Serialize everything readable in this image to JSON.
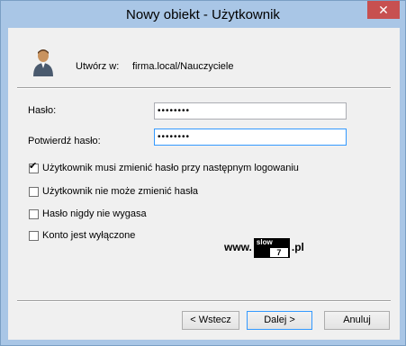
{
  "window": {
    "title": "Nowy obiekt - Użytkownik",
    "close_label": "✕"
  },
  "header": {
    "create_label": "Utwórz w:",
    "create_path": "firma.local/Nauczyciele"
  },
  "form": {
    "password_label": "Hasło:",
    "password_value": "••••••••",
    "confirm_label": "Potwierdź hasło:",
    "confirm_value": "••••••••"
  },
  "options": [
    {
      "label": "Użytkownik musi zmienić hasło przy następnym logowaniu",
      "checked": true
    },
    {
      "label": "Użytkownik nie może zmienić hasła",
      "checked": false
    },
    {
      "label": "Hasło nigdy nie wygasa",
      "checked": false
    },
    {
      "label": "Konto jest wyłączone",
      "checked": false
    }
  ],
  "watermark": {
    "prefix": "www.",
    "box_top": "slow",
    "box_num": "7",
    "suffix": ".pl"
  },
  "buttons": {
    "back": "< Wstecz",
    "next": "Dalej >",
    "cancel": "Anuluj"
  }
}
